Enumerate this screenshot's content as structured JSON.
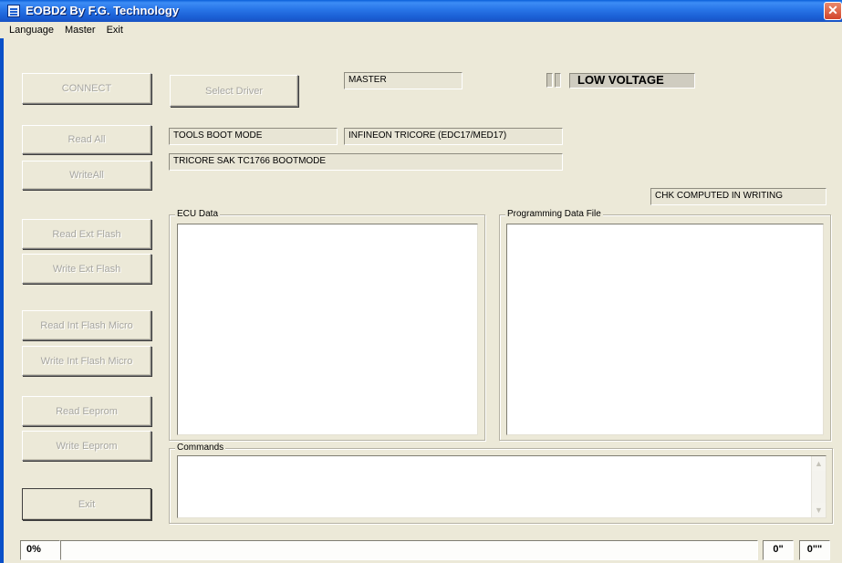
{
  "window": {
    "title": "EOBD2 By F.G. Technology",
    "close_glyph": "✕"
  },
  "menu": {
    "items": [
      "Language",
      "Master",
      "Exit"
    ]
  },
  "buttons": {
    "connect": "CONNECT",
    "select_driver": "Select Driver",
    "read_all": "Read All",
    "write_all": "WriteAll",
    "read_ext_flash": "Read Ext Flash",
    "write_ext_flash": "Write Ext Flash",
    "read_int_flash_micro": "Read Int Flash Micro",
    "write_int_flash_micro": "Write Int Flash Micro",
    "read_eeprom": "Read Eeprom",
    "write_eeprom": "Write Eeprom",
    "exit": "Exit"
  },
  "fields": {
    "mode": "MASTER",
    "voltage_status": "LOW VOLTAGE",
    "boot_mode": "TOOLS BOOT MODE",
    "processor": "INFINEON TRICORE (EDC17/MED17)",
    "boot_detail": "TRICORE SAK TC1766  BOOTMODE",
    "checksum": "CHK COMPUTED IN WRITING"
  },
  "groups": {
    "ecu_data": "ECU Data",
    "programming_data_file": "Programming Data File",
    "commands": "Commands"
  },
  "status": {
    "progress": "0%",
    "message": "",
    "time_a": "0\"",
    "time_b": "0\"\""
  }
}
